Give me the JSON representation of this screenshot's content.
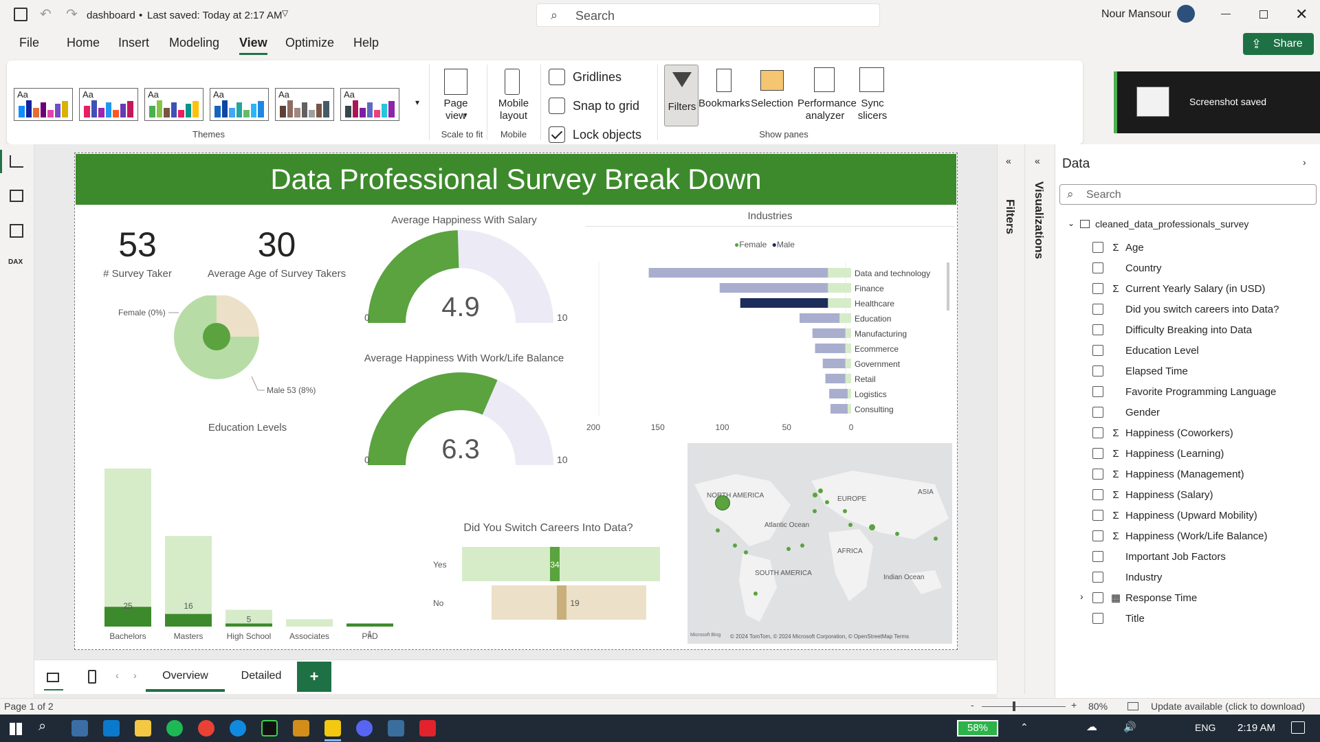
{
  "titlebar": {
    "doc_name": "dashboard",
    "saved_status": "Last saved: Today at 2:17 AM",
    "search_placeholder": "Search",
    "user_name": "Nour Mansour"
  },
  "menu": {
    "items": [
      "File",
      "Home",
      "Insert",
      "Modeling",
      "View",
      "Optimize",
      "Help"
    ],
    "active": "View",
    "share_label": "Share"
  },
  "ribbon": {
    "themes_label": "Themes",
    "page_view_label": "Page view",
    "scale_to_fit_label": "Scale to fit",
    "mobile_layout_label": "Mobile layout",
    "mobile_group_label": "Mobile",
    "gridlines_label": "Gridlines",
    "snap_label": "Snap to grid",
    "lock_label": "Lock objects",
    "filters_label": "Filters",
    "bookmarks_label": "Bookmarks",
    "selection_label": "Selection",
    "performance_label": "Performance analyzer",
    "sync_label": "Sync slicers",
    "show_panes_label": "Show panes"
  },
  "toast": {
    "text": "Screenshot saved"
  },
  "report": {
    "title": "Data Professional Survey Break Down",
    "kpi_takers_value": "53",
    "kpi_takers_label": "# Survey Taker",
    "kpi_age_value": "30",
    "kpi_age_label": "Average Age of Survey Takers",
    "pie_female_label": "Female (0%)",
    "pie_male_label": "Male 53 (8%)",
    "gauge1_title": "Average Happiness With Salary",
    "gauge1_value": "4.9",
    "gauge2_title": "Average Happiness With Work/Life Balance",
    "gauge2_value": "6.3",
    "gauge_min": "0",
    "gauge_max": "10",
    "industries_title": "Industries",
    "legend_female": "Female",
    "legend_male": "Male",
    "education_title": "Education Levels",
    "switch_title": "Did You Switch Careers Into Data?",
    "switch_yes": "Yes",
    "switch_no": "No",
    "map_labels": {
      "na": "NORTH AMERICA",
      "eu": "EUROPE",
      "asia": "ASIA",
      "atl": "Atlantic Ocean",
      "af": "AFRICA",
      "sa": "SOUTH AMERICA",
      "ind": "Indian Ocean"
    },
    "map_attrib": "© 2024 TomTom, © 2024 Microsoft Corporation, © OpenStreetMap  Terms",
    "map_brand": "Microsoft Bing"
  },
  "chart_data": [
    {
      "type": "pie",
      "title": "",
      "categories": [
        "Female",
        "Male"
      ],
      "labels": [
        "Female (0%)",
        "Male 53 (8%)"
      ],
      "values": [
        0.25,
        0.75
      ]
    },
    {
      "type": "gauge",
      "title": "Average Happiness With Salary",
      "value": 4.9,
      "min": 0,
      "max": 10
    },
    {
      "type": "gauge",
      "title": "Average Happiness With Work/Life Balance",
      "value": 6.3,
      "min": 0,
      "max": 10
    },
    {
      "type": "bar",
      "orientation": "horizontal-reversed",
      "title": "Industries",
      "categories": [
        "Data and technology",
        "Finance",
        "Healthcare",
        "Education",
        "Manufacturing",
        "Ecommerce",
        "Government",
        "Retail",
        "Logistics",
        "Consulting"
      ],
      "series": [
        {
          "name": "Female",
          "values": [
            20,
            20,
            20,
            10,
            5,
            5,
            5,
            5,
            3,
            3
          ]
        },
        {
          "name": "Male",
          "values": [
            157,
            102,
            86,
            40,
            30,
            28,
            22,
            20,
            17,
            16
          ]
        }
      ],
      "highlighted_category": "Healthcare",
      "xlim": [
        200,
        0
      ],
      "xticks": [
        200,
        150,
        100,
        50,
        0
      ]
    },
    {
      "type": "bar",
      "title": "Education Levels",
      "categories": [
        "Bachelors",
        "Masters",
        "High School",
        "Associates",
        "PhD"
      ],
      "values": [
        25,
        16,
        5,
        0,
        1
      ],
      "totals": [
        150,
        86,
        16,
        7,
        2
      ]
    },
    {
      "type": "bar",
      "orientation": "horizontal",
      "title": "Did You Switch Careers Into Data?",
      "categories": [
        "Yes",
        "No"
      ],
      "values": [
        34,
        19
      ],
      "totals": [
        320,
        250
      ]
    }
  ],
  "pages": {
    "tabs": [
      "Overview",
      "Detailed"
    ],
    "active": "Overview",
    "add_label": "+"
  },
  "panes": {
    "filters_label": "Filters",
    "viz_label": "Visualizations",
    "data_title": "Data",
    "data_search_placeholder": "Search",
    "table_name": "cleaned_data_professionals_survey",
    "fields": [
      {
        "name": "Age",
        "sigma": true
      },
      {
        "name": "Country",
        "sigma": false
      },
      {
        "name": "Current Yearly Salary (in USD)",
        "sigma": true
      },
      {
        "name": "Did you switch careers into Data?",
        "sigma": false
      },
      {
        "name": "Difficulty Breaking into Data",
        "sigma": false
      },
      {
        "name": "Education Level",
        "sigma": false
      },
      {
        "name": "Elapsed Time",
        "sigma": false
      },
      {
        "name": "Favorite Programming Language",
        "sigma": false
      },
      {
        "name": "Gender",
        "sigma": false
      },
      {
        "name": "Happiness (Coworkers)",
        "sigma": true
      },
      {
        "name": "Happiness (Learning)",
        "sigma": true
      },
      {
        "name": "Happiness (Management)",
        "sigma": true
      },
      {
        "name": "Happiness (Salary)",
        "sigma": true
      },
      {
        "name": "Happiness (Upward Mobility)",
        "sigma": true
      },
      {
        "name": "Happiness (Work/Life Balance)",
        "sigma": true
      },
      {
        "name": "Important Job Factors",
        "sigma": false
      },
      {
        "name": "Industry",
        "sigma": false
      },
      {
        "name": "Response Time",
        "sigma": false,
        "calendar": true
      },
      {
        "name": "Title",
        "sigma": false
      }
    ]
  },
  "status": {
    "page": "Page 1 of 2",
    "zoom": "80%",
    "update": "Update available (click to download)"
  },
  "taskbar": {
    "battery": "58%",
    "lang": "ENG",
    "time": "2:19 AM"
  },
  "colors": {
    "green": "#3d8a2c",
    "light_green": "#b8dca6",
    "pale_green": "#d6ecc9",
    "beige": "#ece0c8",
    "navy": "#1d2d5a",
    "lavender": "#a9aecf"
  }
}
